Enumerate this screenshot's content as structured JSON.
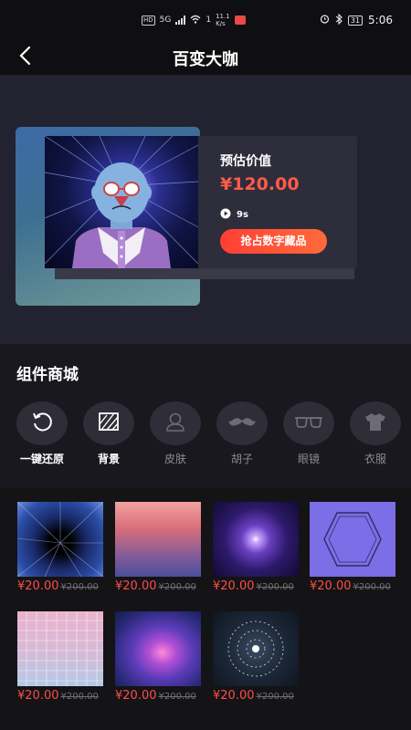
{
  "status_bar": {
    "network_badge": "HD",
    "network_type": "5G",
    "speed_count": "1",
    "speed_value": "11.1",
    "speed_unit": "K/s",
    "battery": "31",
    "time": "5:06"
  },
  "nav": {
    "title": "百变大咖",
    "back_icon": "chevron-left-icon"
  },
  "hero": {
    "price_label": "预估价值",
    "price": "¥120.00",
    "duration": "9s",
    "cta": "抢占数字藏品"
  },
  "components": {
    "title": "组件商城",
    "tools": [
      {
        "label": "一键还原",
        "icon": "reset-icon",
        "active": true
      },
      {
        "label": "背景",
        "icon": "background-icon",
        "active": true
      },
      {
        "label": "皮肤",
        "icon": "skin-icon",
        "active": false
      },
      {
        "label": "胡子",
        "icon": "mustache-icon",
        "active": false
      },
      {
        "label": "眼镜",
        "icon": "glasses-icon",
        "active": false
      },
      {
        "label": "衣服",
        "icon": "clothes-icon",
        "active": false
      }
    ]
  },
  "shop": {
    "items": [
      {
        "price": "¥20.00",
        "original": "¥200.00"
      },
      {
        "price": "¥20.00",
        "original": "¥200.00"
      },
      {
        "price": "¥20.00",
        "original": "¥200.00"
      },
      {
        "price": "¥20.00",
        "original": "¥200.00"
      },
      {
        "price": "¥20.00",
        "original": "¥200.00"
      },
      {
        "price": "¥20.00",
        "original": "¥200.00"
      },
      {
        "price": "¥20.00",
        "original": "¥200.00"
      }
    ]
  },
  "colors": {
    "accent": "#ff4d45",
    "background": "#19181e",
    "button": "#ff4f37"
  }
}
